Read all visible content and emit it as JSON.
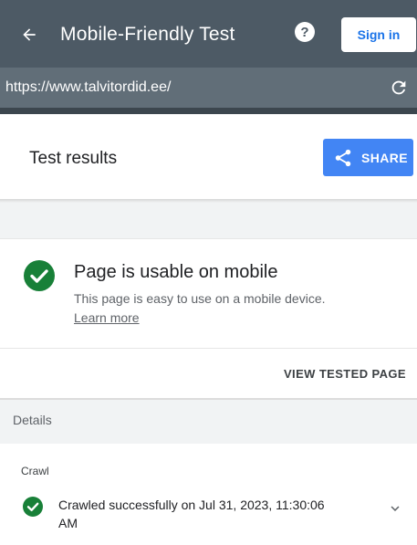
{
  "header": {
    "title": "Mobile-Friendly Test",
    "help_glyph": "?",
    "signin_label": "Sign in",
    "bg_color": "#4d5a65"
  },
  "urlbar": {
    "url": "https://www.talvitordid.ee/"
  },
  "results": {
    "title": "Test results",
    "share_label": "SHARE",
    "accent_color": "#4285f4"
  },
  "verdict": {
    "title": "Page is usable on mobile",
    "description": "This page is easy to use on a mobile device.",
    "learn_more": "Learn more",
    "status_color": "#188038"
  },
  "actions": {
    "view_tested_page": "VIEW TESTED PAGE"
  },
  "details": {
    "label": "Details",
    "crawl": {
      "label": "Crawl",
      "status_text": "Crawled successfully on Jul 31, 2023, 11:30:06 AM"
    }
  },
  "icons": {
    "back": "arrow-left-icon",
    "help": "help-icon",
    "reload": "reload-icon",
    "share": "share-icon",
    "check": "check-circle-icon",
    "expand": "chevron-down-icon"
  }
}
